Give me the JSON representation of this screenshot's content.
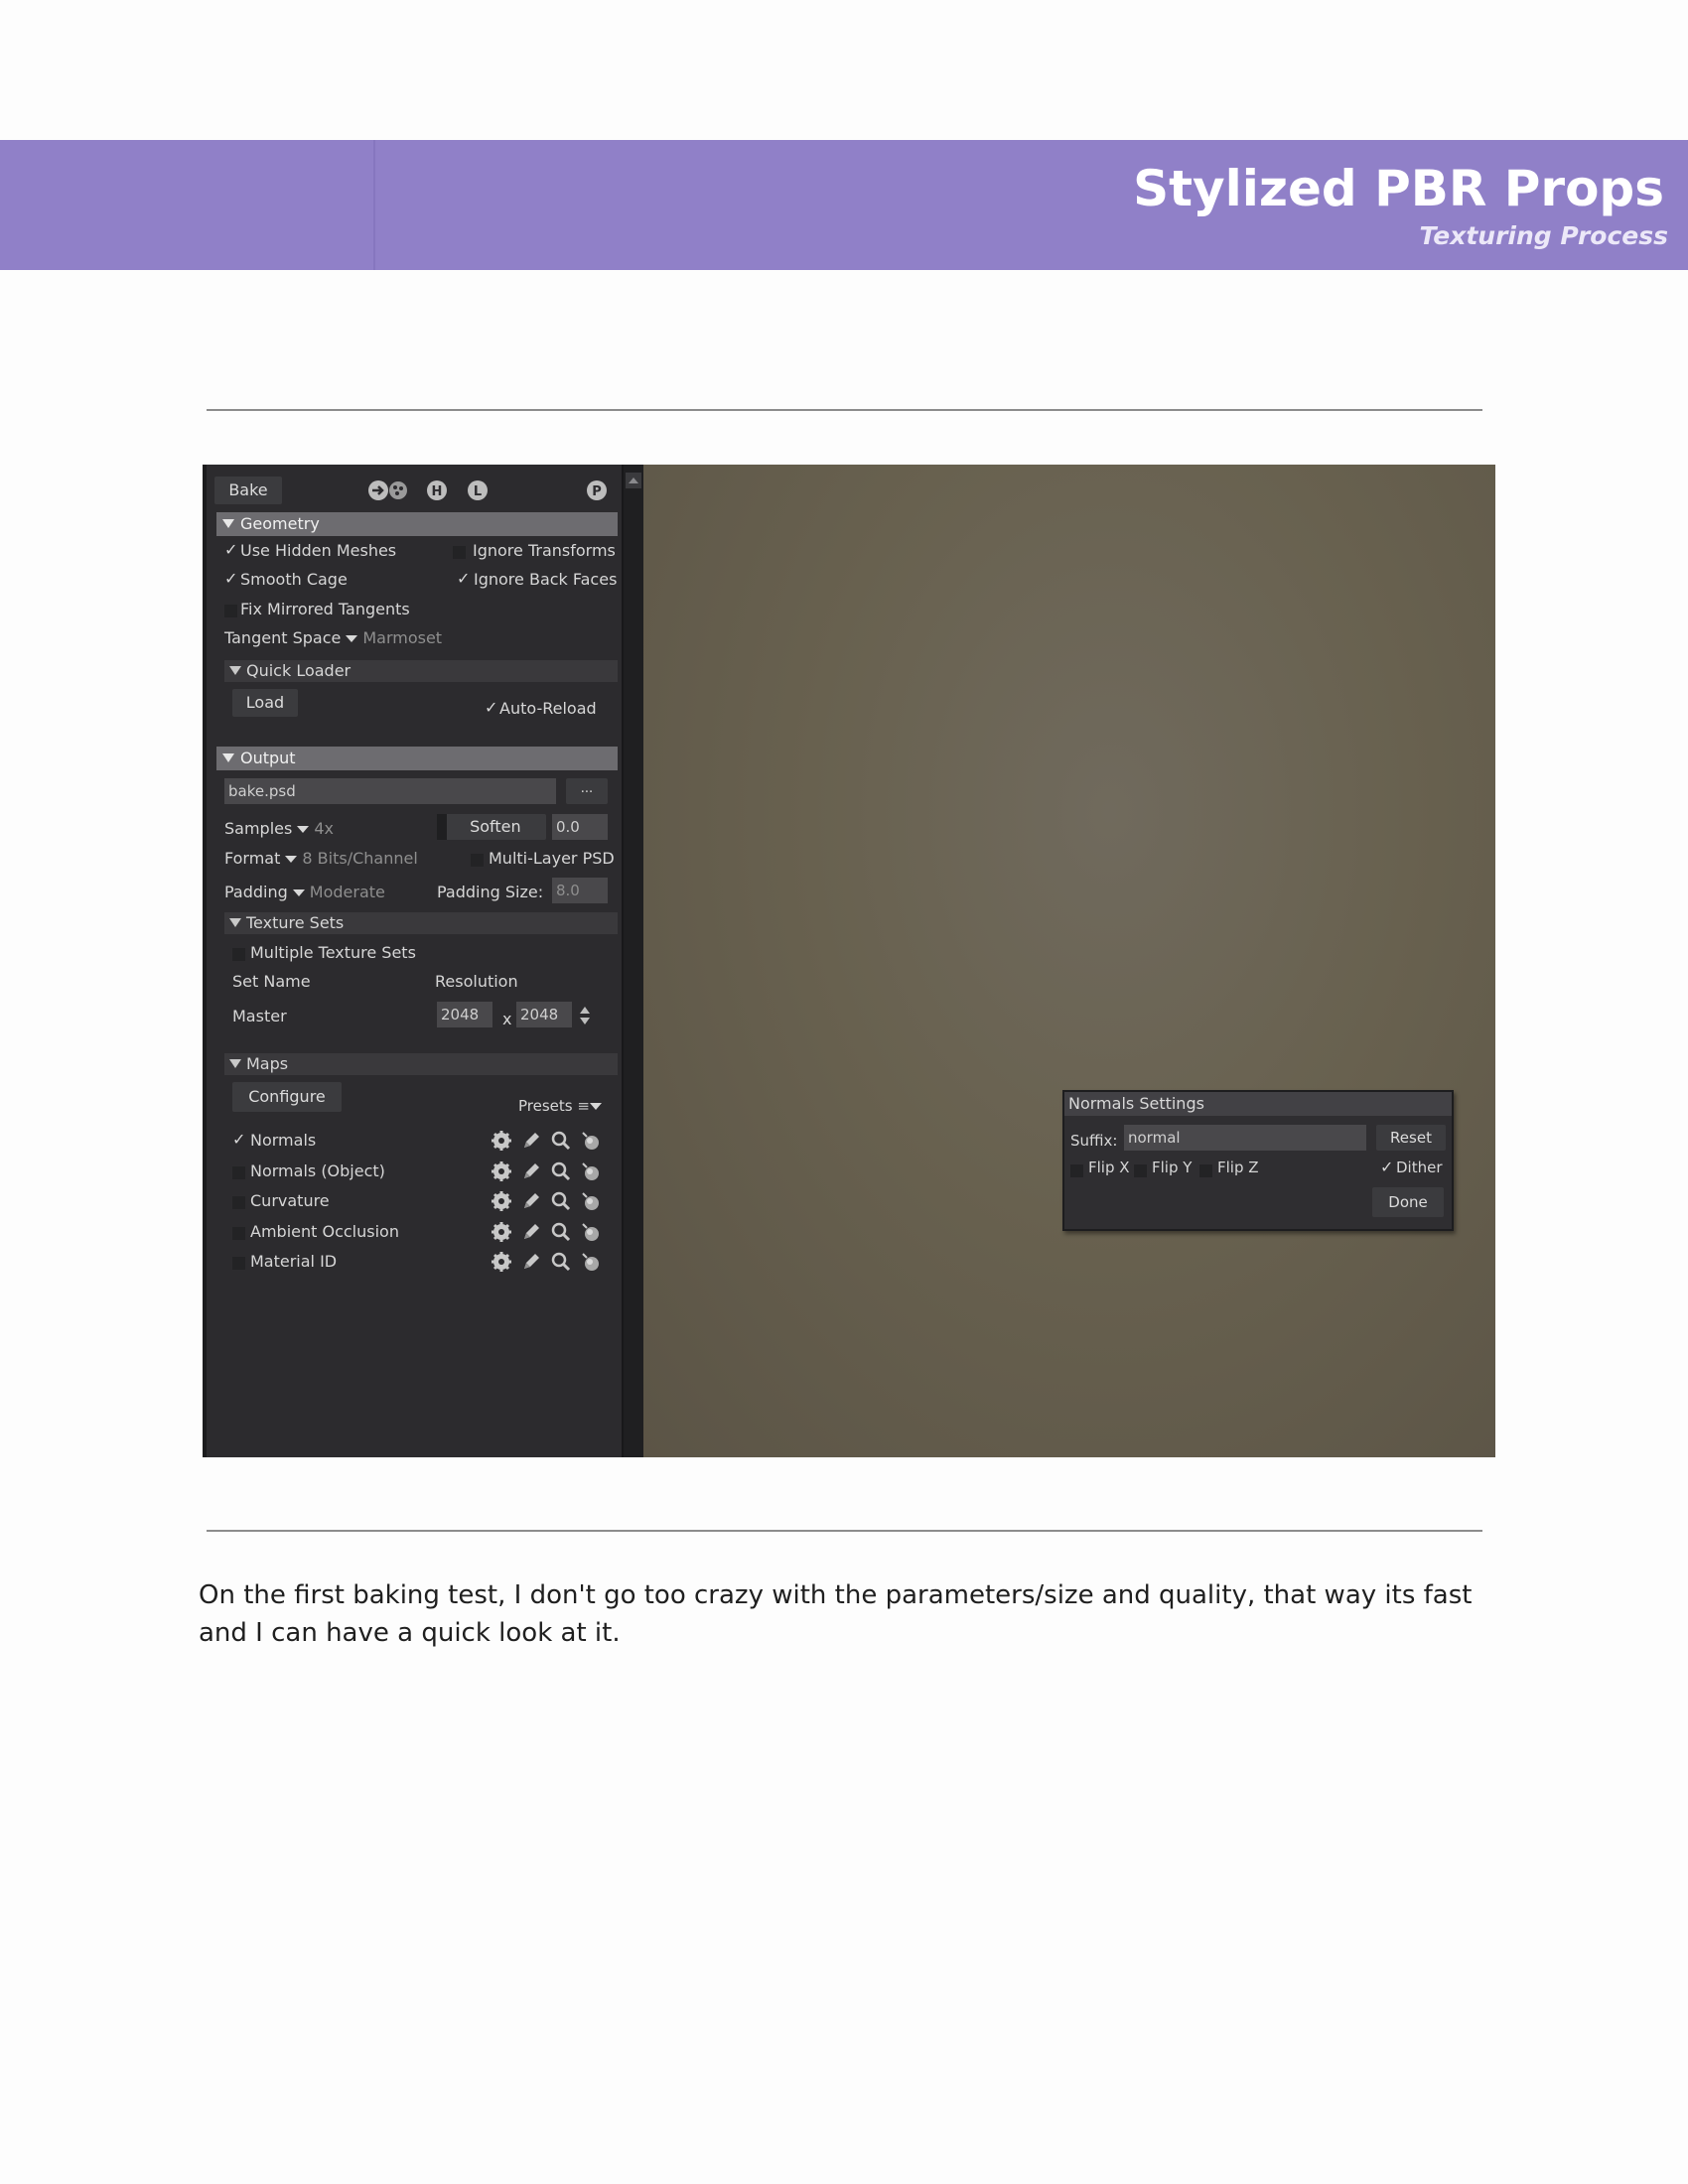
{
  "header": {
    "title": "Stylized PBR Props",
    "subtitle": "Texturing Process"
  },
  "panel": {
    "bake_button": "Bake",
    "header_icons": [
      "arrows-icon",
      "h-icon",
      "l-icon",
      "p-icon"
    ],
    "geometry": {
      "title": "Geometry",
      "use_hidden_meshes": {
        "label": "Use Hidden Meshes",
        "checked": true
      },
      "ignore_transforms": {
        "label": "Ignore Transforms",
        "checked": false
      },
      "smooth_cage": {
        "label": "Smooth Cage",
        "checked": true
      },
      "ignore_back_faces": {
        "label": "Ignore Back Faces",
        "checked": true
      },
      "fix_mirrored_tangents": {
        "label": "Fix Mirrored Tangents",
        "checked": false
      },
      "tangent_space_label": "Tangent Space",
      "tangent_space_value": "Marmoset",
      "quick_loader": {
        "title": "Quick Loader",
        "load": "Load",
        "auto_reload": "Auto-Reload"
      }
    },
    "output": {
      "title": "Output",
      "file": "bake.psd",
      "browse": "...",
      "samples_label": "Samples",
      "samples_value": "4x",
      "soften_label": "Soften",
      "soften_value": "0.0",
      "format_label": "Format",
      "format_value": "8 Bits/Channel",
      "multilayer_psd": "Multi-Layer PSD",
      "padding_label": "Padding",
      "padding_value": "Moderate",
      "padding_size_label": "Padding Size:",
      "padding_size_value": "8.0",
      "texture_sets": {
        "title": "Texture Sets",
        "multiple": "Multiple Texture Sets",
        "col_set_name": "Set Name",
        "col_resolution": "Resolution",
        "row_name": "Master",
        "res_w": "2048",
        "res_x": "x",
        "res_h": "2048"
      }
    },
    "maps": {
      "title": "Maps",
      "configure": "Configure",
      "presets": "Presets",
      "items": [
        {
          "label": "Normals",
          "checked": true
        },
        {
          "label": "Normals (Object)",
          "checked": false
        },
        {
          "label": "Curvature",
          "checked": false
        },
        {
          "label": "Ambient Occlusion",
          "checked": false
        },
        {
          "label": "Material ID",
          "checked": false
        }
      ]
    }
  },
  "normals_dialog": {
    "title": "Normals Settings",
    "suffix_label": "Suffix:",
    "suffix_value": "normal",
    "reset": "Reset",
    "flip_x": "Flip X",
    "flip_y": "Flip Y",
    "flip_z": "Flip Z",
    "dither": "Dither",
    "done": "Done"
  },
  "body": {
    "paragraph": "On the first baking test, I don't go too crazy with the parameters/size and quality, that way its fast and I can have a quick look at it."
  }
}
